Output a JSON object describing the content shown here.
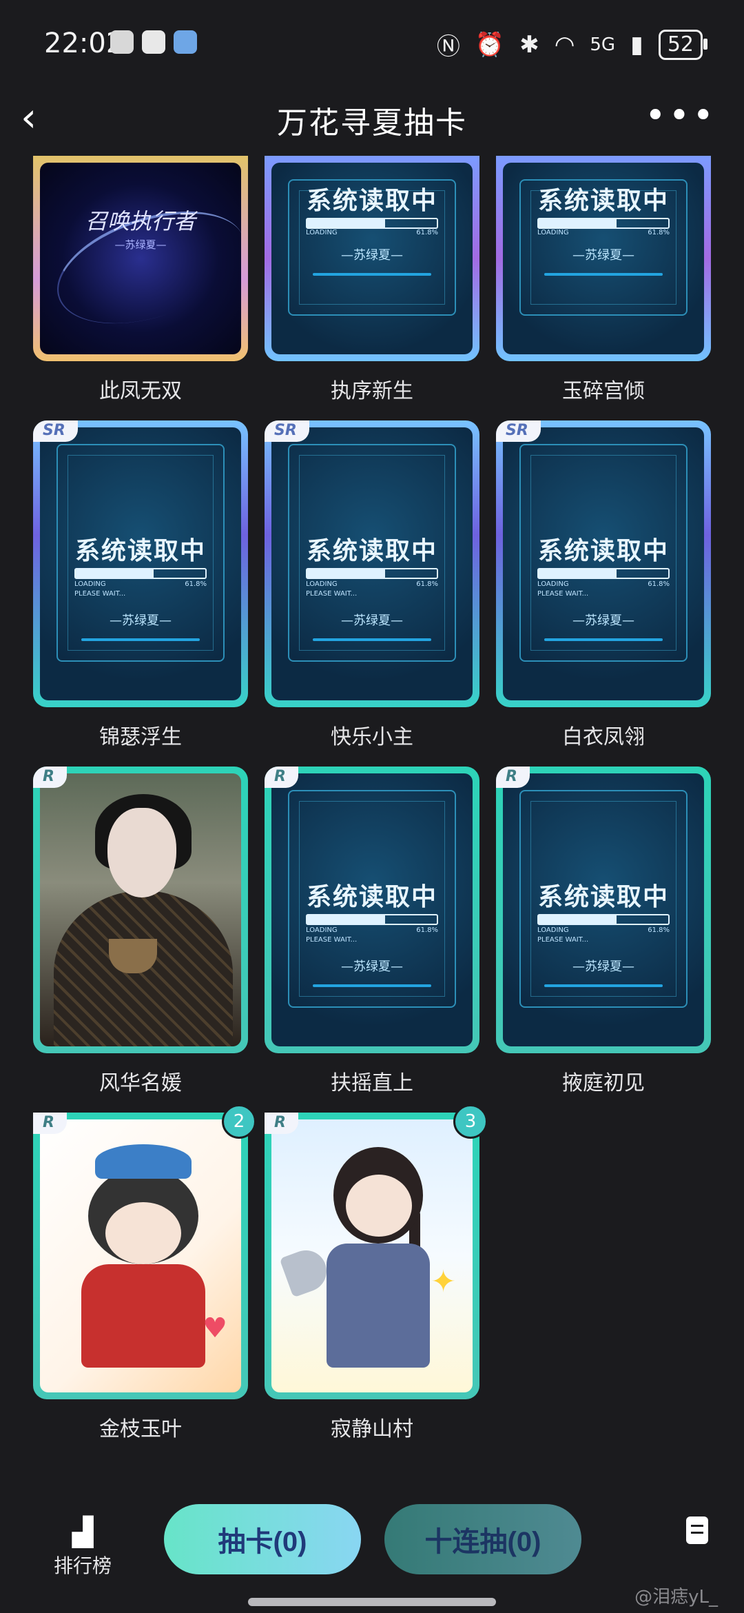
{
  "status_bar": {
    "time": "22:02",
    "network": "5G",
    "battery": "52",
    "icons": [
      "nfc-icon",
      "alarm-icon",
      "bluetooth-icon",
      "wifi-icon",
      "signal-icon"
    ]
  },
  "header": {
    "title": "万花寻夏抽卡",
    "back_icon": "chevron-left-icon",
    "more_label": "•••"
  },
  "loading_card": {
    "text": "系统读取中",
    "loading_label": "LOADING",
    "please_wait": "PLEASE WAIT...",
    "percent": "61.8%",
    "name": "—苏绿夏—"
  },
  "summon_card": {
    "title": "召唤执行者",
    "subtitle": "—苏绿夏—"
  },
  "cards": [
    {
      "name": "此凤无双",
      "rarity": "",
      "art": "summon"
    },
    {
      "name": "执序新生",
      "rarity": "",
      "art": "loading"
    },
    {
      "name": "玉碎宫倾",
      "rarity": "",
      "art": "loading"
    },
    {
      "name": "锦瑟浮生",
      "rarity": "SR",
      "art": "loading"
    },
    {
      "name": "快乐小主",
      "rarity": "SR",
      "art": "loading"
    },
    {
      "name": "白衣凤翎",
      "rarity": "SR",
      "art": "loading"
    },
    {
      "name": "风华名媛",
      "rarity": "R",
      "art": "portrait"
    },
    {
      "name": "扶摇直上",
      "rarity": "R",
      "art": "loading"
    },
    {
      "name": "掖庭初见",
      "rarity": "R",
      "art": "loading"
    },
    {
      "name": "金枝玉叶",
      "rarity": "R",
      "art": "chibi1",
      "count": "2"
    },
    {
      "name": "寂静山村",
      "rarity": "R",
      "art": "chibi2",
      "count": "3"
    }
  ],
  "bottom_bar": {
    "rank_label": "排行榜",
    "draw_label": "抽卡(0)",
    "ten_draw_label": "十连抽(0)"
  },
  "watermark": "@泪痣yL_"
}
